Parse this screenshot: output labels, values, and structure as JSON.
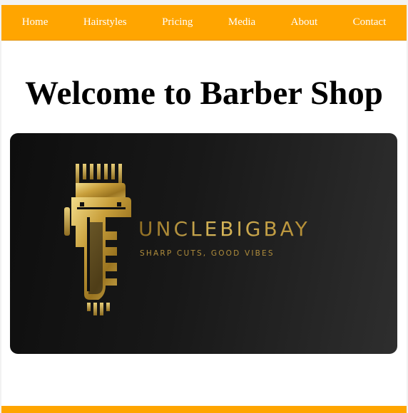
{
  "nav": {
    "items": [
      {
        "label": "Home"
      },
      {
        "label": "Hairstyles"
      },
      {
        "label": "Pricing"
      },
      {
        "label": "Media"
      },
      {
        "label": "About"
      },
      {
        "label": "Contact"
      }
    ]
  },
  "main": {
    "title": "Welcome to Barber Shop"
  },
  "banner": {
    "brand_name": "UNCLEBIGBAY",
    "tagline": "SHARP CUTS, GOOD VIBES",
    "logo_icon": "hair-clipper-icon"
  },
  "colors": {
    "nav_background": "#ffa500",
    "nav_text": "#ffffff",
    "banner_background": "#1a1a1a",
    "gold": "#c9a64a"
  }
}
